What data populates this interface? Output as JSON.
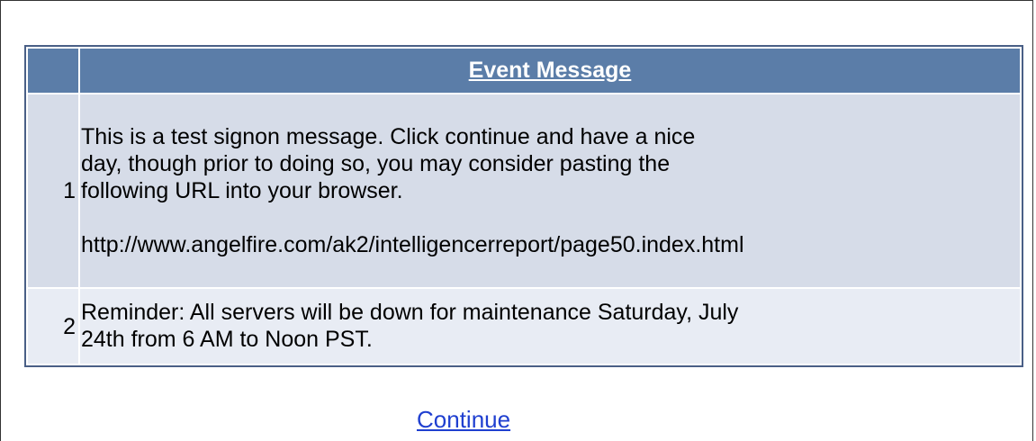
{
  "grid": {
    "header": {
      "number_column": "",
      "message_column": "Event Message"
    },
    "rows": [
      {
        "number": "1",
        "message_lines": [
          "This is a test signon message. Click continue and have a nice",
          "day, though prior to doing so, you may consider pasting the",
          "following URL into your browser.",
          "",
          "http://www.angelfire.com/ak2/intelligencerreport/page50.index.html"
        ]
      },
      {
        "number": "2",
        "message_lines": [
          "Reminder: All servers will be down for maintenance Saturday, July",
          "24th from 6 AM to Noon PST."
        ]
      }
    ]
  },
  "actions": {
    "continue_label": "Continue"
  },
  "colors": {
    "header_bg": "#5b7da8",
    "row_bg": "#d6dce8",
    "alt_row_bg": "#e8ecf4",
    "grid_border": "#4a5f86",
    "link": "#1f3fd0"
  }
}
